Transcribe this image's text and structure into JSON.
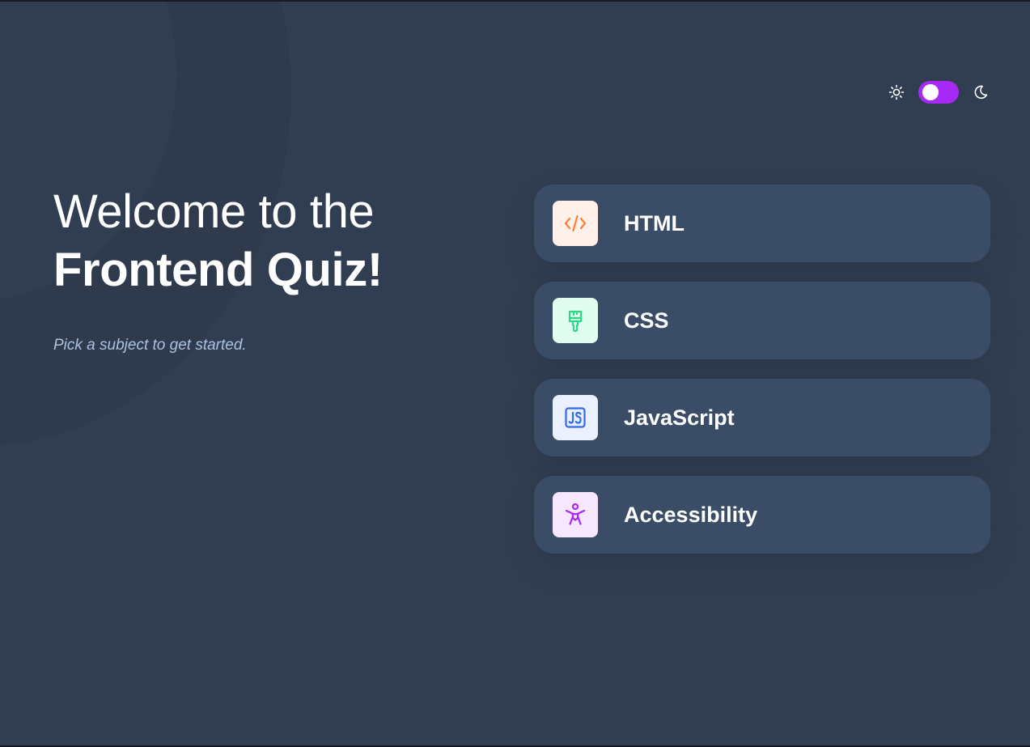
{
  "theme_toggle": {
    "light_icon": "sun-icon",
    "dark_icon": "moon-icon",
    "state": "dark"
  },
  "intro": {
    "title_line1": "Welcome to the",
    "title_line2": "Frontend Quiz!",
    "subtitle": "Pick a subject to get started."
  },
  "subjects": [
    {
      "label": "HTML",
      "icon": "html-icon",
      "icon_bg": "#fff1e9",
      "icon_color": "#ff7e35"
    },
    {
      "label": "CSS",
      "icon": "css-icon",
      "icon_bg": "#e0fdef",
      "icon_color": "#2fd887"
    },
    {
      "label": "JavaScript",
      "icon": "javascript-icon",
      "icon_bg": "#ebf0ff",
      "icon_color": "#306af1"
    },
    {
      "label": "Accessibility",
      "icon": "accessibility-icon",
      "icon_bg": "#f6e7ff",
      "icon_color": "#a729f5"
    }
  ],
  "colors": {
    "background": "#313e51",
    "card": "#3b4d66",
    "accent": "#a729f5",
    "text": "#ffffff",
    "muted_text": "#abc1e1"
  }
}
